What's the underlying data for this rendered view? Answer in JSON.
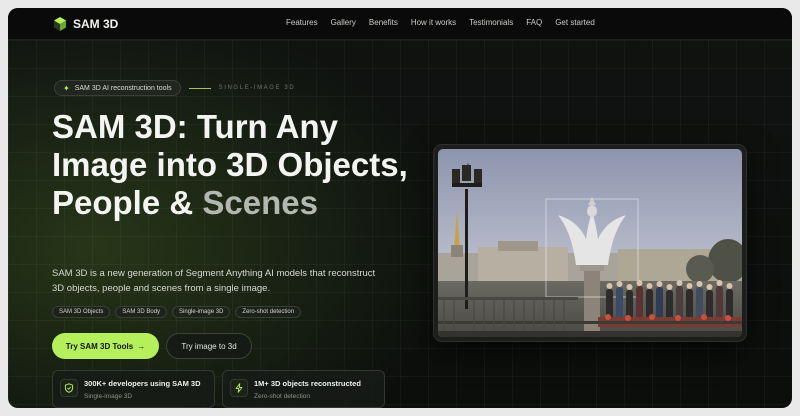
{
  "brand": {
    "name": "SAM 3D",
    "accent": "#b5f05c"
  },
  "nav": {
    "links": [
      "Features",
      "Gallery",
      "Benefits",
      "How it works",
      "Testimonials",
      "FAQ",
      "Get started"
    ]
  },
  "hero": {
    "badge": {
      "icon": "sparkle-icon",
      "text": "SAM 3D AI reconstruction tools",
      "tag": "SINGLE-IMAGE 3D"
    },
    "title_main": "SAM 3D: Turn Any Image into 3D Objects, People &",
    "title_dim": "Scenes",
    "description": "SAM 3D is a new generation of Segment Anything AI models that reconstruct 3D objects, people and scenes from a single image.",
    "chips": [
      "SAM 3D Objects",
      "SAM 3D Body",
      "Single-image 3D",
      "Zero-shot detection"
    ],
    "primary_button": "Try SAM 3D Tools",
    "primary_button_icon": "arrow-right-icon",
    "secondary_button": "Try image to 3d",
    "stats": [
      {
        "icon": "shield-icon",
        "title": "300K+ developers using SAM 3D",
        "subtitle": "Single-image 3D"
      },
      {
        "icon": "lightning-icon",
        "title": "1M+ 3D objects reconstructed",
        "subtitle": "Zero-shot detection"
      }
    ]
  }
}
